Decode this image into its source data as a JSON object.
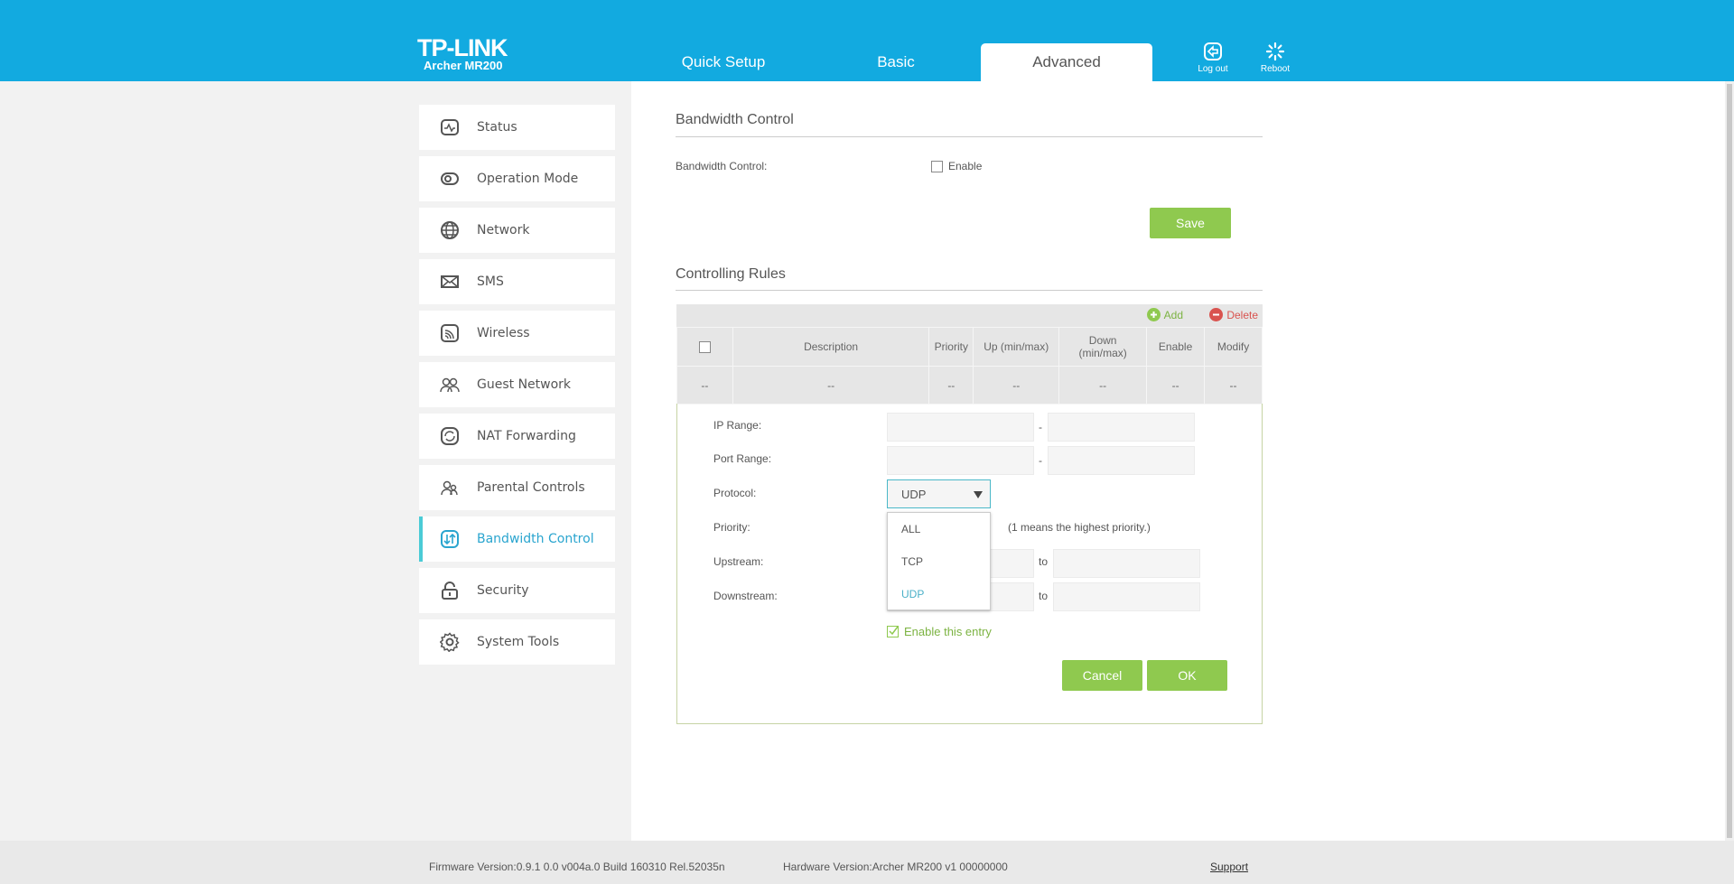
{
  "header": {
    "logo": "TP-LINK",
    "model": "Archer MR200",
    "tabs": [
      {
        "label": "Quick Setup"
      },
      {
        "label": "Basic"
      },
      {
        "label": "Advanced",
        "active": true
      }
    ],
    "logout": "Log out",
    "reboot": "Reboot",
    "color": "#12aae0"
  },
  "sidebar": {
    "items": [
      {
        "label": "Status",
        "icon": "status-icon"
      },
      {
        "label": "Operation Mode",
        "icon": "operation-mode-icon"
      },
      {
        "label": "Network",
        "icon": "globe-icon"
      },
      {
        "label": "SMS",
        "icon": "envelope-icon"
      },
      {
        "label": "Wireless",
        "icon": "wireless-icon"
      },
      {
        "label": "Guest Network",
        "icon": "guest-icon"
      },
      {
        "label": "NAT Forwarding",
        "icon": "refresh-icon"
      },
      {
        "label": "Parental Controls",
        "icon": "parental-icon"
      },
      {
        "label": "Bandwidth Control",
        "icon": "bandwidth-icon",
        "active": true
      },
      {
        "label": "Security",
        "icon": "lock-icon"
      },
      {
        "label": "System Tools",
        "icon": "gear-icon"
      }
    ]
  },
  "bandwidth": {
    "title": "Bandwidth Control",
    "label": "Bandwidth Control:",
    "enable_label": "Enable",
    "enabled": false,
    "save": "Save"
  },
  "rules": {
    "title": "Controlling Rules",
    "add": "Add",
    "delete": "Delete",
    "columns": [
      "Description",
      "Priority",
      "Up (min/max)",
      "Down (min/max)",
      "Enable",
      "Modify"
    ],
    "row": [
      "--",
      "--",
      "--",
      "--",
      "--",
      "--",
      "--"
    ]
  },
  "form": {
    "ip_range": "IP Range:",
    "port_range": "Port Range:",
    "protocol": "Protocol:",
    "priority": "Priority:",
    "upstream": "Upstream:",
    "downstream": "Downstream:",
    "dash": "-",
    "to": "to",
    "protocol_value": "UDP",
    "protocol_options": [
      "ALL",
      "TCP",
      "UDP"
    ],
    "priority_hint": "(1 means the highest priority.)",
    "enable_entry": "Enable this entry",
    "enable_entry_checked": true,
    "cancel": "Cancel",
    "ok": "OK"
  },
  "footer": {
    "firmware": "Firmware Version:0.9.1 0.0 v004a.0 Build 160310 Rel.52035n",
    "hardware": "Hardware Version:Archer MR200 v1 00000000",
    "support": "Support"
  }
}
